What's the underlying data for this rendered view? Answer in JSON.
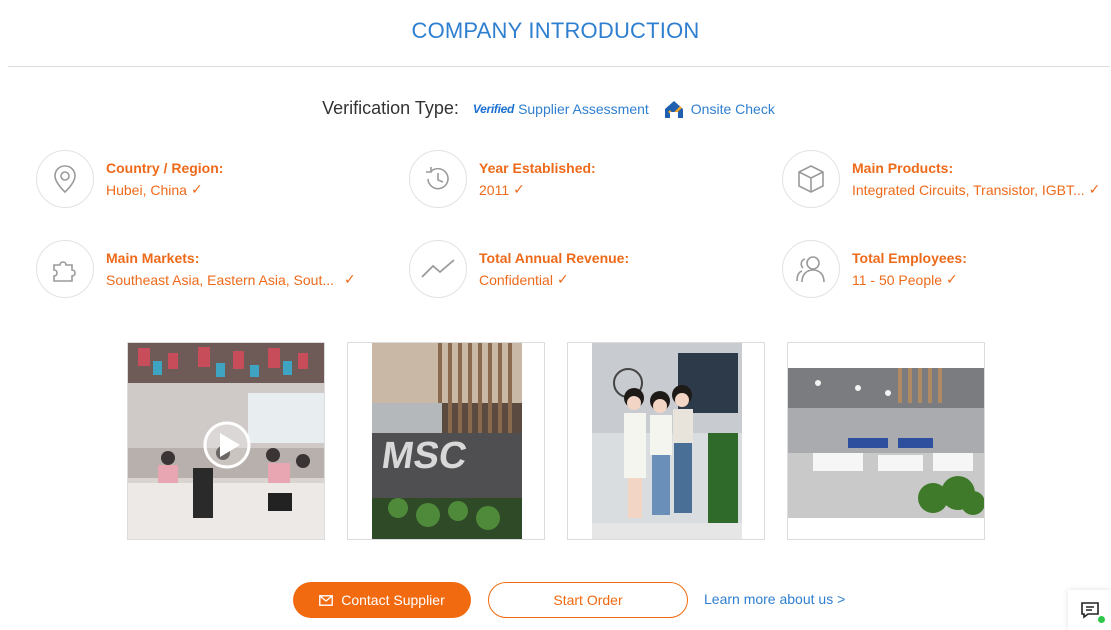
{
  "section": {
    "title": "COMPANY INTRODUCTION"
  },
  "verification": {
    "label": "Verification Type:",
    "verified_mark": "Verified",
    "supplier_assessment": "Supplier Assessment",
    "onsite_check": "Onsite Check"
  },
  "info": [
    {
      "icon": "location-pin-icon",
      "label": "Country / Region:",
      "value": "Hubei, China"
    },
    {
      "icon": "history-clock-icon",
      "label": "Year Established:",
      "value": "2011"
    },
    {
      "icon": "product-box-icon",
      "label": "Main Products:",
      "value": "Integrated Circuits, Transistor, IGBT..."
    },
    {
      "icon": "puzzle-piece-icon",
      "label": "Main Markets:",
      "value": "Southeast Asia, Eastern Asia, Sout..."
    },
    {
      "icon": "trend-line-icon",
      "label": "Total Annual Revenue:",
      "value": "Confidential"
    },
    {
      "icon": "people-icon",
      "label": "Total Employees:",
      "value": "11 - 50 People"
    }
  ],
  "checkmark": "✓",
  "photos": [
    {
      "name": "office-video-photo",
      "has_play": true
    },
    {
      "name": "msc-logo-wall-photo",
      "has_play": false
    },
    {
      "name": "team-photo",
      "has_play": false
    },
    {
      "name": "office-interior-photo",
      "has_play": false
    }
  ],
  "actions": {
    "contact_supplier": "Contact Supplier",
    "start_order": "Start Order",
    "learn_more": "Learn more about us >"
  },
  "colors": {
    "accent_orange": "#f26a10",
    "link_blue": "#2f7fd0"
  }
}
